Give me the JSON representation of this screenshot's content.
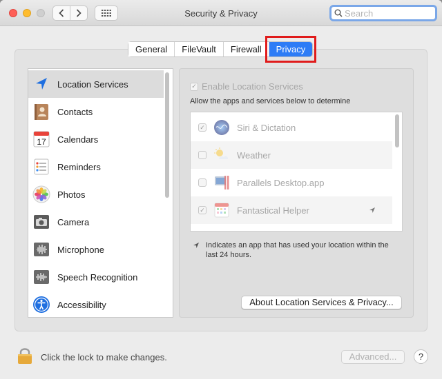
{
  "window": {
    "title": "Security & Privacy"
  },
  "search": {
    "placeholder": "Search"
  },
  "tabs": [
    {
      "label": "General"
    },
    {
      "label": "FileVault"
    },
    {
      "label": "Firewall"
    },
    {
      "label": "Privacy",
      "active": true
    }
  ],
  "sidebar": {
    "items": [
      {
        "label": "Location Services",
        "icon": "location-arrow-icon",
        "selected": true
      },
      {
        "label": "Contacts",
        "icon": "contacts-icon"
      },
      {
        "label": "Calendars",
        "icon": "calendar-icon"
      },
      {
        "label": "Reminders",
        "icon": "reminders-icon"
      },
      {
        "label": "Photos",
        "icon": "photos-icon"
      },
      {
        "label": "Camera",
        "icon": "camera-icon"
      },
      {
        "label": "Microphone",
        "icon": "microphone-icon"
      },
      {
        "label": "Speech Recognition",
        "icon": "speech-recognition-icon"
      },
      {
        "label": "Accessibility",
        "icon": "accessibility-icon"
      }
    ]
  },
  "calendar_day": "17",
  "location": {
    "enable_label": "Enable Location Services",
    "enable_checked": true,
    "allow_text": "Allow the apps and services below to determine",
    "apps": [
      {
        "label": "Siri & Dictation",
        "checked": true,
        "icon": "siri-icon",
        "recent": false
      },
      {
        "label": "Weather",
        "checked": false,
        "icon": "weather-icon",
        "recent": false
      },
      {
        "label": "Parallels Desktop.app",
        "checked": false,
        "icon": "parallels-icon",
        "recent": false
      },
      {
        "label": "Fantastical Helper",
        "checked": true,
        "icon": "fantastical-icon",
        "recent": true
      }
    ],
    "note": "Indicates an app that has used your location within the last 24 hours.",
    "about_button": "About Location Services & Privacy..."
  },
  "footer": {
    "lock_text": "Click the lock to make changes.",
    "advanced_button": "Advanced...",
    "help_button": "?"
  },
  "colors": {
    "accent": "#2d7cf6",
    "highlight_box": "#e01b1b",
    "close": "#fe5f57",
    "minimize": "#febc2e"
  }
}
